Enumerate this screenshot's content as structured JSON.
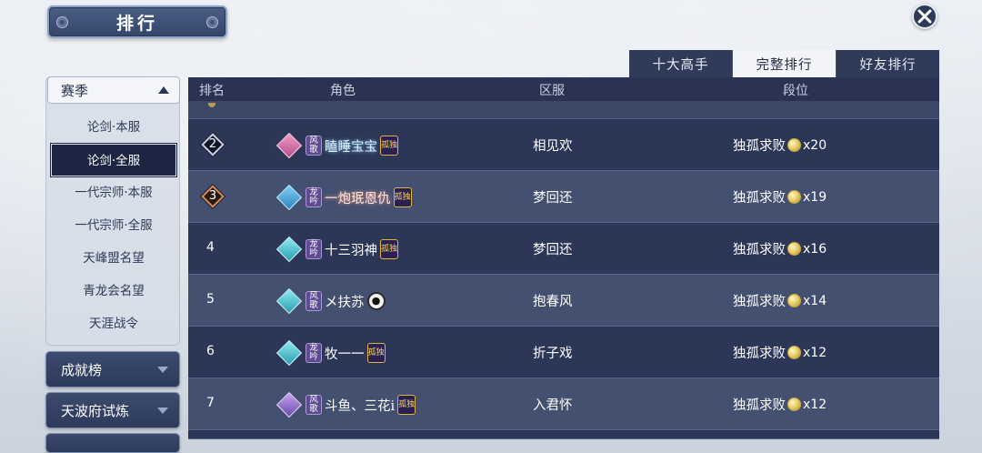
{
  "title": "排行",
  "tabs": [
    {
      "label": "十大高手",
      "active": false
    },
    {
      "label": "完整排行",
      "active": true
    },
    {
      "label": "好友排行",
      "active": false
    }
  ],
  "sidebar": {
    "season_header": "赛季",
    "season_items": [
      {
        "label": "论剑·本服",
        "active": false
      },
      {
        "label": "论剑·全服",
        "active": true
      },
      {
        "label": "一代宗师·本服",
        "active": false
      },
      {
        "label": "一代宗师·全服",
        "active": false
      },
      {
        "label": "天峰盟名望",
        "active": false
      },
      {
        "label": "青龙会名望",
        "active": false
      },
      {
        "label": "天涯战令",
        "active": false
      }
    ],
    "achievement_label": "成就榜",
    "trial_label": "天波府试炼"
  },
  "table": {
    "headers": {
      "rank": "排名",
      "role": "角色",
      "server": "区服",
      "tier": "段位"
    },
    "rows": [
      {
        "rank": "2",
        "rank_style": "silver",
        "sect_color": "pink",
        "badge": "风歌",
        "name": "瞌睡宝宝",
        "name_style": "fancy",
        "title_badge": "孤独",
        "server": "相见欢",
        "tier": "独孤求败",
        "count": "x20"
      },
      {
        "rank": "3",
        "rank_style": "bronze",
        "sect_color": "blue",
        "badge": "龙吟",
        "name": "一炮珉恩仇",
        "name_style": "fancy2",
        "title_badge": "孤独",
        "server": "梦回还",
        "tier": "独孤求败",
        "count": "x19"
      },
      {
        "rank": "4",
        "rank_style": "plain",
        "sect_color": "cyan",
        "badge": "龙吟",
        "name": "十三羽神",
        "name_style": "normal",
        "title_badge": "孤独",
        "server": "梦回还",
        "tier": "独孤求败",
        "count": "x16"
      },
      {
        "rank": "5",
        "rank_style": "plain",
        "sect_color": "cyan",
        "badge": "风歌",
        "name": "メ扶苏",
        "name_style": "normal",
        "title_badge": "",
        "server": "抱春风",
        "tier": "独孤求败",
        "count": "x14"
      },
      {
        "rank": "6",
        "rank_style": "plain",
        "sect_color": "cyan",
        "badge": "龙吟",
        "name": "牧一一",
        "name_style": "normal",
        "title_badge": "孤独",
        "server": "折子戏",
        "tier": "独孤求败",
        "count": "x12"
      },
      {
        "rank": "7",
        "rank_style": "plain",
        "sect_color": "purple",
        "badge": "风歌",
        "name": "斗鱼、三花i",
        "name_style": "normal",
        "title_badge": "孤独",
        "server": "入君怀",
        "tier": "独孤求败",
        "count": "x12"
      }
    ]
  },
  "colors": {
    "panel_dark": "#2c3656",
    "panel_light": "#44506f",
    "accent_gold": "#e5c55a"
  },
  "icons": {
    "close": "close-icon",
    "expand": "chevron-up-icon",
    "collapse": "chevron-down-icon",
    "coin": "coin-icon"
  }
}
